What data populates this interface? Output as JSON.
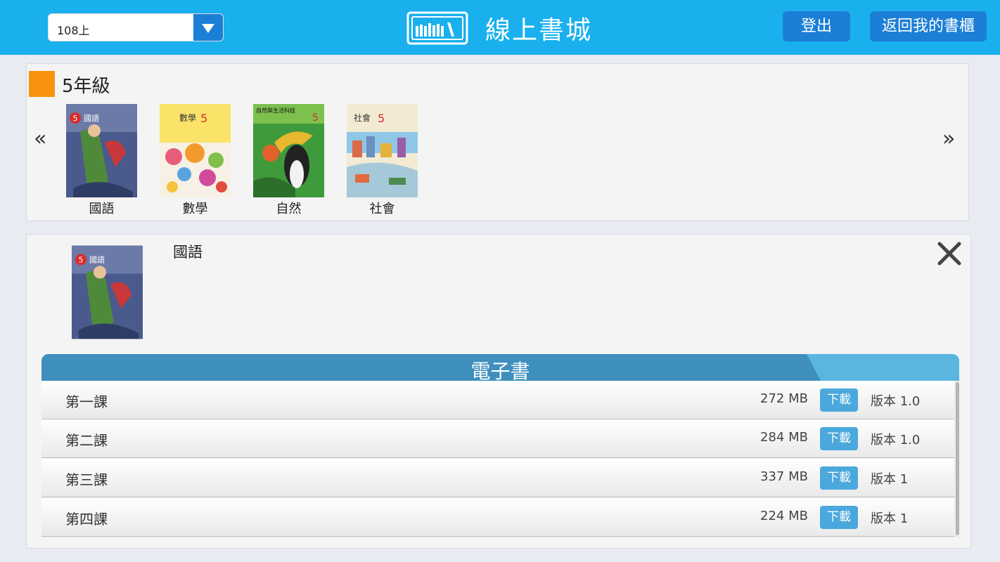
{
  "header": {
    "term_select": {
      "value": "108上"
    },
    "title": "線上書城",
    "logout_label": "登出",
    "back_label": "返回我的書櫃",
    "colors": {
      "bar": "#1ab0ee",
      "button": "#1c7fd6"
    }
  },
  "grade": {
    "label": "5年級",
    "marker_color": "#f8920f",
    "prev_label": "«",
    "next_label": "»",
    "books": [
      {
        "title": "國語",
        "cover_text": "國語",
        "badge": "5"
      },
      {
        "title": "數學",
        "cover_text": "數學",
        "badge": "5"
      },
      {
        "title": "自然",
        "cover_text": "自然與生活科技",
        "badge": "5"
      },
      {
        "title": "社會",
        "cover_text": "社會",
        "badge": "5"
      }
    ]
  },
  "detail": {
    "title": "國語",
    "section_label": "電子書",
    "download_label": "下載",
    "items": [
      {
        "name": "第一課",
        "size": "272 MB",
        "version": "版本 1.0"
      },
      {
        "name": "第二課",
        "size": "284 MB",
        "version": "版本 1.0"
      },
      {
        "name": "第三課",
        "size": "337 MB",
        "version": "版本 1"
      },
      {
        "name": "第四課",
        "size": "224 MB",
        "version": "版本 1"
      }
    ]
  }
}
